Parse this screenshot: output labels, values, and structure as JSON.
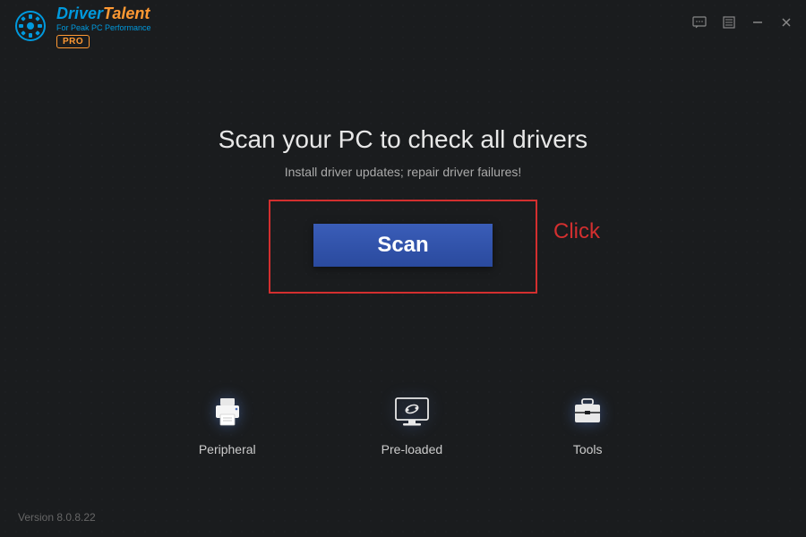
{
  "logo": {
    "name_part1": "Driver",
    "name_part2": "Talent",
    "subtitle": "For Peak PC Performance",
    "badge": "PRO"
  },
  "main": {
    "heading": "Scan your PC to check all drivers",
    "subheading": "Install driver updates; repair driver failures!",
    "scan_button_label": "Scan"
  },
  "annotation": {
    "click_label": "Click"
  },
  "bottom_nav": {
    "items": [
      {
        "label": "Peripheral"
      },
      {
        "label": "Pre-loaded"
      },
      {
        "label": "Tools"
      }
    ]
  },
  "footer": {
    "version": "Version 8.0.8.22"
  }
}
